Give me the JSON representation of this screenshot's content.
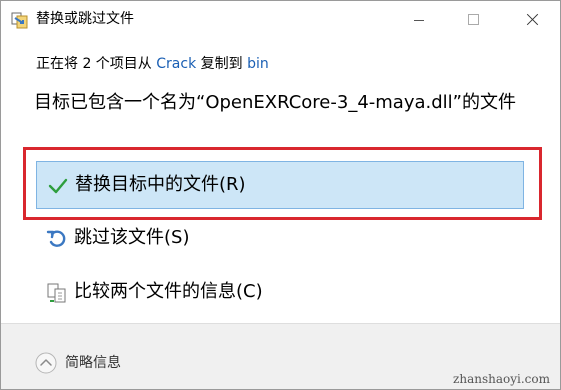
{
  "window": {
    "title": "替换或跳过文件"
  },
  "status": {
    "prefix": "正在将 2 个项目从 ",
    "source": "Crack",
    "middle": " 复制到 ",
    "destination": "bin"
  },
  "message": "目标已包含一个名为“OpenEXRCore-3_4-maya.dll”的文件",
  "options": [
    {
      "label": "替换目标中的文件(R)",
      "icon": "check-icon"
    },
    {
      "label": "跳过该文件(S)",
      "icon": "skip-arrow-icon"
    },
    {
      "label": "比较两个文件的信息(C)",
      "icon": "compare-files-icon"
    }
  ],
  "footer": {
    "details_label": "简略信息",
    "watermark": "zhanshaoyi.com"
  },
  "colors": {
    "highlight_border": "#d9272e",
    "selected_option_bg": "#cde6f7",
    "link": "#1a5fb4",
    "check": "#2e9e3e"
  }
}
